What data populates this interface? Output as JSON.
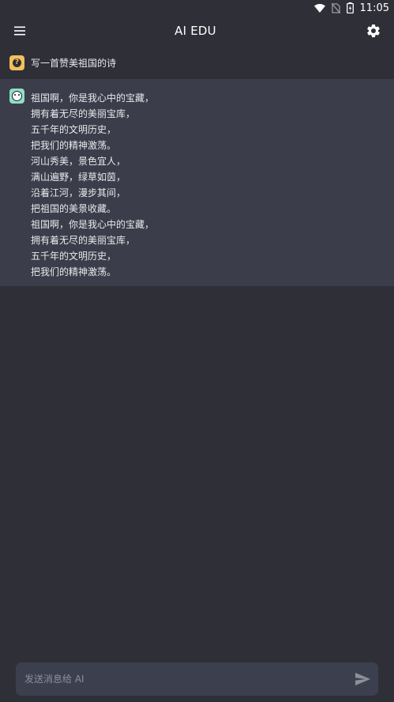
{
  "status_bar": {
    "time": "11:05",
    "icons": [
      "wifi-icon",
      "no-sim-icon",
      "battery-icon"
    ]
  },
  "app_bar": {
    "title": "AI EDU",
    "left_icon": "menu-icon",
    "right_icon": "gear-icon"
  },
  "conversation": {
    "question": {
      "avatar_icon": "user-question-icon",
      "text": "写一首赞美祖国的诗"
    },
    "answer": {
      "avatar_icon": "ai-bot-icon",
      "lines": [
        "祖国啊，你是我心中的宝藏，",
        "拥有着无尽的美丽宝库，",
        "五千年的文明历史，",
        "把我们的精神激荡。",
        "河山秀美，景色宜人，",
        "满山遍野，绿草如茵，",
        "沿着江河，漫步其间，",
        "把祖国的美景收藏。",
        "祖国啊，你是我心中的宝藏，",
        "拥有着无尽的美丽宝库，",
        "五千年的文明历史，",
        "把我们的精神激荡。"
      ]
    }
  },
  "composer": {
    "placeholder": "发送消息给 AI",
    "value": "",
    "send_icon": "send-icon"
  },
  "colors": {
    "background": "#2f2f38",
    "answer_background": "#3c3d4a",
    "question_avatar": "#f2c15a",
    "ai_avatar": "#8fe0c8",
    "input_background": "#3c3f4e"
  }
}
